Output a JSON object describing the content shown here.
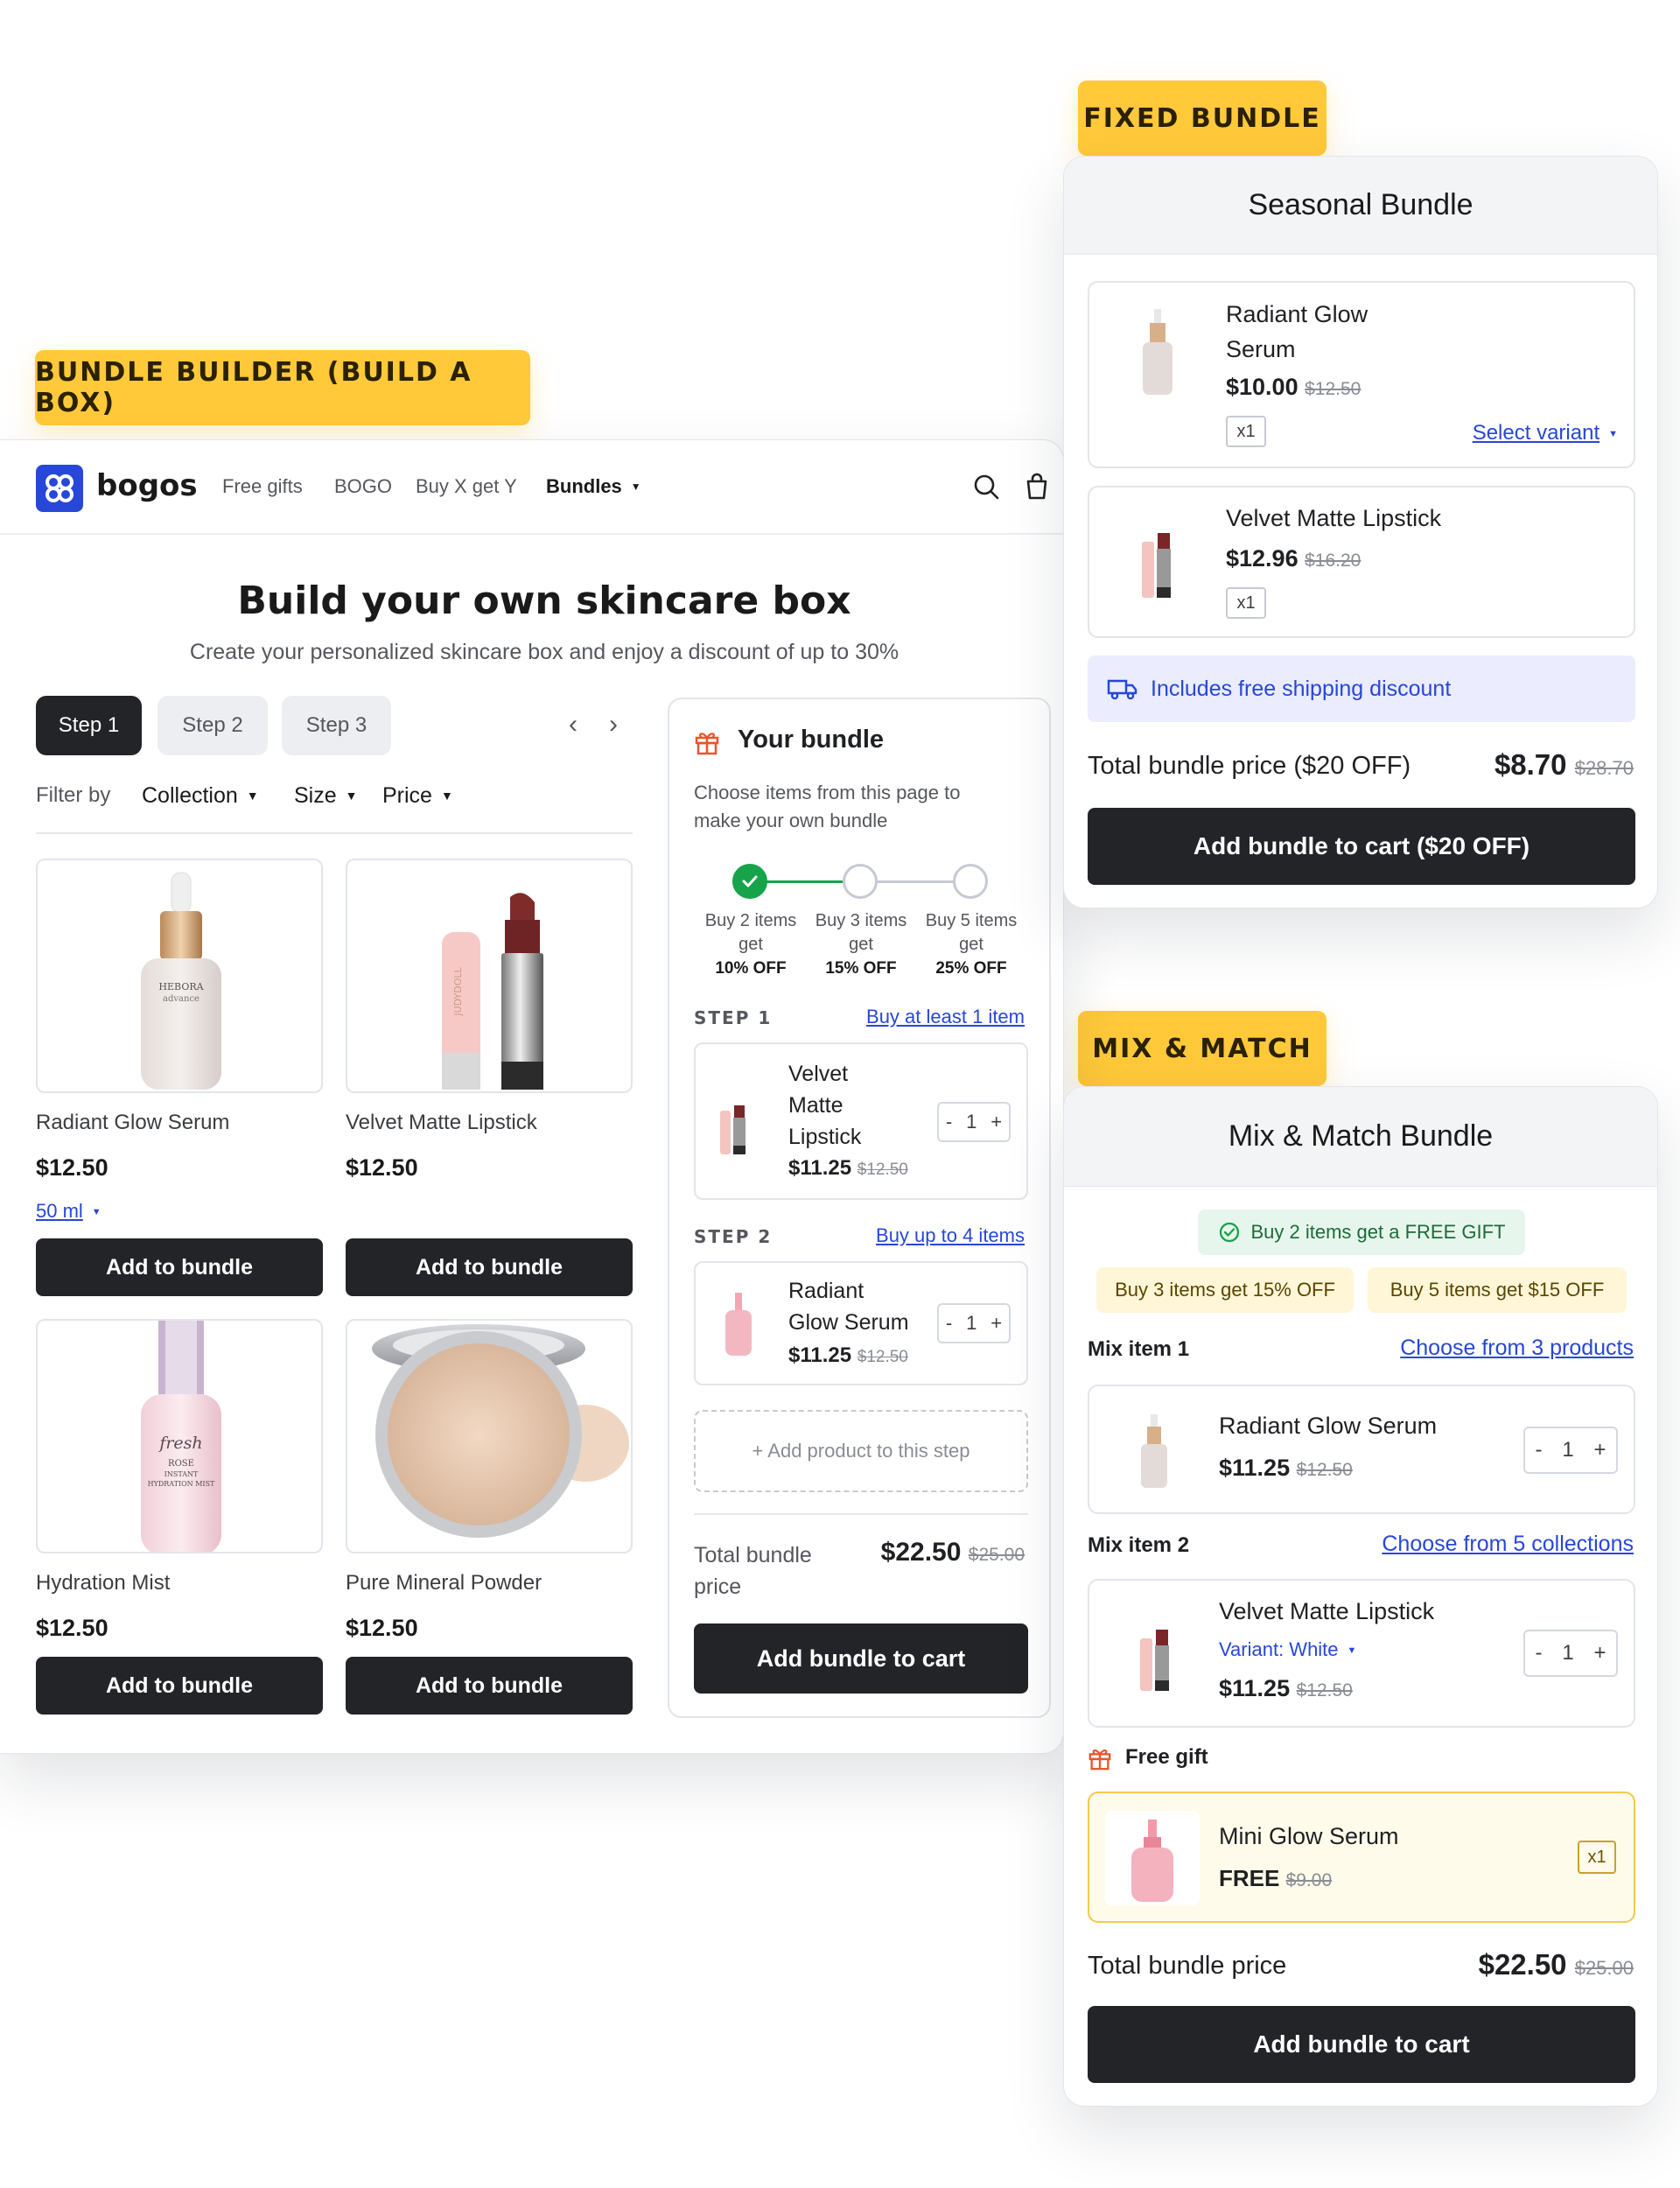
{
  "tags": {
    "fixed": "FIXED BUNDLE",
    "builder": "BUNDLE BUILDER (BUILD A BOX)",
    "mix": "MIX & MATCH"
  },
  "builder": {
    "logo": "bogos",
    "nav": [
      "Free gifts",
      "BOGO",
      "Buy X get Y",
      "Bundles"
    ],
    "title": "Build your own skincare box",
    "subtitle": "Create your personalized skincare box and enjoy a discount of up to 30%",
    "steps": [
      "Step 1",
      "Step 2",
      "Step 3"
    ],
    "filter_label": "Filter by",
    "filters": [
      "Collection",
      "Size",
      "Price"
    ],
    "products": [
      {
        "name": "Radiant Glow Serum",
        "price": "$12.50",
        "variant": "50 ml",
        "button": "Add to bundle"
      },
      {
        "name": "Velvet Matte Lipstick",
        "price": "$12.50",
        "button": "Add to bundle"
      },
      {
        "name": "Hydration Mist",
        "price": "$12.50",
        "button": "Add to bundle"
      },
      {
        "name": "Pure Mineral Powder",
        "price": "$12.50",
        "button": "Add to bundle"
      }
    ],
    "product_image_text": {
      "serum_brand": "HEBORA",
      "serum_line": "advance",
      "mist_brand": "fresh",
      "mist_line1": "ROSE",
      "mist_line2": "INSTANT",
      "mist_line3": "HYDRATION MIST",
      "lipstick_brand": "JUDYDOLL"
    },
    "your_bundle": {
      "title": "Your bundle",
      "desc_line1": "Choose items from this page to",
      "desc_line2": "make your own bundle",
      "tiers": [
        {
          "l1": "Buy 2 items",
          "l2": "get",
          "l3": "10% OFF"
        },
        {
          "l1": "Buy 3 items",
          "l2": "get",
          "l3": "15% OFF"
        },
        {
          "l1": "Buy 5 items",
          "l2": "get",
          "l3": "25% OFF"
        }
      ],
      "step1": {
        "label": "STEP 1",
        "link": "Buy at least 1 item",
        "item_l1": "Velvet",
        "item_l2": "Matte",
        "item_l3": "Lipstick",
        "price": "$11.25",
        "old": "$12.50",
        "qty": "1"
      },
      "step2": {
        "label": "STEP 2",
        "link": "Buy up to 4 items",
        "item_l1": "Radiant",
        "item_l2": "Glow Serum",
        "price": "$11.25",
        "old": "$12.50",
        "qty": "1"
      },
      "add_product": "+ Add product to this step",
      "total_l1": "Total bundle",
      "total_l2": "price",
      "total": "$22.50",
      "total_old": "$25.00",
      "cta": "Add bundle to cart"
    }
  },
  "fixed": {
    "title": "Seasonal Bundle",
    "items": [
      {
        "name_l1": "Radiant Glow",
        "name_l2": "Serum",
        "price": "$10.00",
        "old": "$12.50",
        "qty": "x1",
        "variant_link": "Select variant"
      },
      {
        "name_l1": "Velvet Matte Lipstick",
        "price": "$12.96",
        "old": "$16.20",
        "qty": "x1"
      }
    ],
    "shipping": "Includes free shipping discount",
    "total_label": "Total bundle price ($20 OFF)",
    "total": "$8.70",
    "total_old": "$28.70",
    "cta": "Add bundle to cart ($20 OFF)"
  },
  "mix": {
    "title": "Mix & Match Bundle",
    "offer_gift": "Buy 2 items get a FREE GIFT",
    "offer_a": "Buy 3 items get 15% OFF",
    "offer_b": "Buy 5 items get $15 OFF",
    "item1": {
      "label": "Mix item 1",
      "link": "Choose from 3 products",
      "name": "Radiant Glow Serum",
      "price": "$11.25",
      "old": "$12.50",
      "qty": "1"
    },
    "item2": {
      "label": "Mix item 2",
      "link": "Choose from 5 collections",
      "name": "Velvet Matte Lipstick",
      "variant": "Variant: White",
      "price": "$11.25",
      "old": "$12.50",
      "qty": "1"
    },
    "gift_label": "Free gift",
    "gift": {
      "name": "Mini Glow Serum",
      "price": "FREE",
      "old": "$9.00",
      "qty": "x1"
    },
    "total_label": "Total bundle price",
    "total": "$22.50",
    "total_old": "$25.00",
    "cta": "Add bundle to cart"
  },
  "colors": {
    "accent": "#2747d8",
    "dark": "#232428",
    "tag": "#ffc93a",
    "success": "#17a34a",
    "gift": "#e8562c"
  }
}
